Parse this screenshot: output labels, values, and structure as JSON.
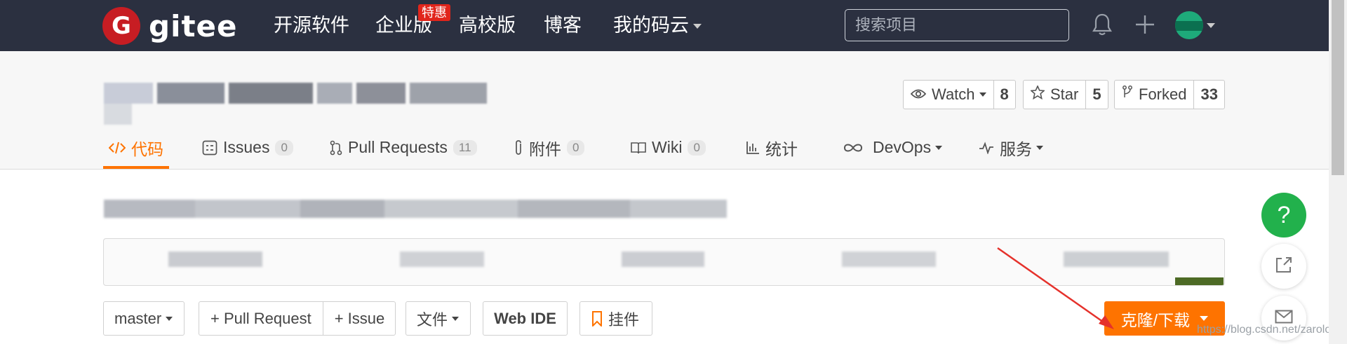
{
  "topnav": {
    "logo_letter": "G",
    "logo_text": "gitee",
    "items": [
      "开源软件",
      "企业版",
      "高校版",
      "博客",
      "我的码云"
    ],
    "enterprise_badge": "特惠",
    "search_placeholder": "搜索项目"
  },
  "project": {
    "stats": {
      "watch_label": "Watch",
      "watch_count": "8",
      "star_label": "Star",
      "star_count": "5",
      "forked_label": "Forked",
      "forked_count": "33"
    },
    "tabs": [
      {
        "label": "代码"
      },
      {
        "label": "Issues",
        "count": "0"
      },
      {
        "label": "Pull Requests",
        "count": "11"
      },
      {
        "label": "附件",
        "count": "0"
      },
      {
        "label": "Wiki",
        "count": "0"
      },
      {
        "label": "统计"
      },
      {
        "label": "DevOps"
      },
      {
        "label": "服务"
      }
    ]
  },
  "toolbar": {
    "branch": "master",
    "pull_request": "+ Pull Request",
    "issue": "+ Issue",
    "file": "文件",
    "web_ide": "Web IDE",
    "widget": "挂件",
    "clone": "克隆/下载"
  },
  "floating": {
    "help": "?"
  },
  "watermark": "https://blog.csdn.net/zarolord",
  "colors": {
    "accent": "#fe7300",
    "nav_bg": "#2b3040",
    "brand": "#c71d23",
    "help": "#22b14c"
  }
}
